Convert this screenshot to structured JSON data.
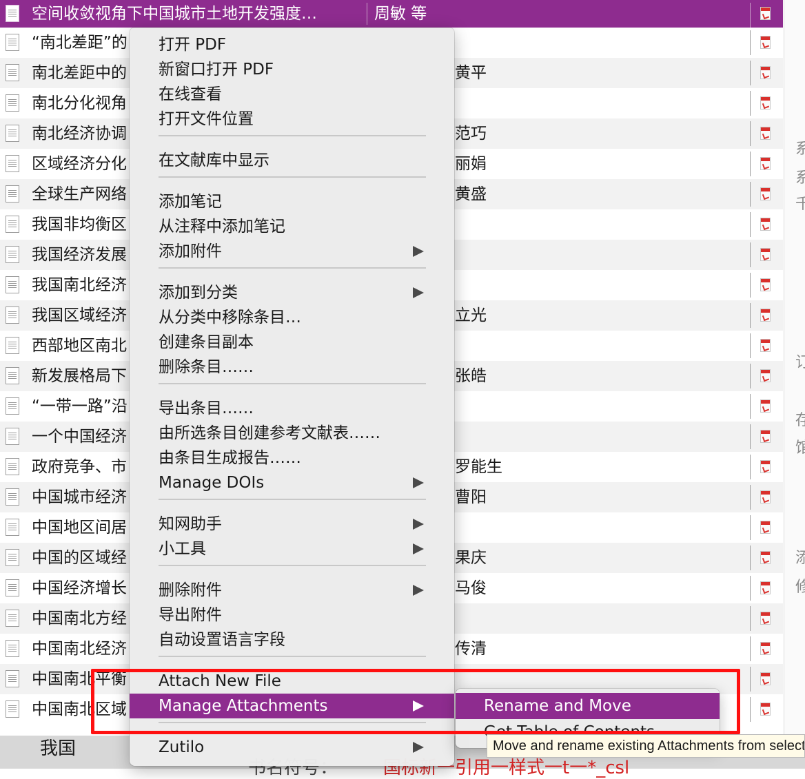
{
  "items": [
    {
      "title": "空间收敛视角下中国城市土地开发强度…",
      "creator": "周敏 等",
      "selected": true
    },
    {
      "title": "“南北差距”的",
      "creator": ""
    },
    {
      "title": "南北差距中的",
      "creator": "黄平"
    },
    {
      "title": "南北分化视角",
      "creator": ""
    },
    {
      "title": "南北经济协调",
      "creator": "范巧"
    },
    {
      "title": "区域经济分化",
      "creator": "丽娟"
    },
    {
      "title": "全球生产网络",
      "creator": "黄盛"
    },
    {
      "title": "我国非均衡区",
      "creator": ""
    },
    {
      "title": "我国经济发展",
      "creator": ""
    },
    {
      "title": "我国南北经济",
      "creator": ""
    },
    {
      "title": "我国区域经济",
      "creator": "立光"
    },
    {
      "title": "西部地区南北",
      "creator": ""
    },
    {
      "title": "新发展格局下",
      "creator": "张皓"
    },
    {
      "title": "“一带一路”沿",
      "creator": ""
    },
    {
      "title": "一个中国经济",
      "creator": ""
    },
    {
      "title": "政府竞争、市",
      "creator": "罗能生"
    },
    {
      "title": "中国城市经济",
      "creator": "曹阳"
    },
    {
      "title": "中国地区间居",
      "creator": ""
    },
    {
      "title": "中国的区域经",
      "creator": "果庆"
    },
    {
      "title": "中国经济增长",
      "creator": "马俊"
    },
    {
      "title": "中国南北方经",
      "creator": ""
    },
    {
      "title": "中国南北经济",
      "creator": "传清"
    },
    {
      "title": "中国南北平衡",
      "creator": ""
    },
    {
      "title": "中国南北区域",
      "creator": ""
    }
  ],
  "context_menu": {
    "groups": [
      [
        {
          "label": "打开 PDF"
        },
        {
          "label": "新窗口打开 PDF"
        },
        {
          "label": "在线查看"
        },
        {
          "label": "打开文件位置"
        }
      ],
      [
        {
          "label": "在文献库中显示"
        }
      ],
      [
        {
          "label": "添加笔记"
        },
        {
          "label": "从注释中添加笔记"
        },
        {
          "label": "添加附件",
          "submenu": true
        }
      ],
      [
        {
          "label": "添加到分类",
          "submenu": true
        },
        {
          "label": "从分类中移除条目…"
        },
        {
          "label": "创建条目副本"
        },
        {
          "label": "删除条目……"
        }
      ],
      [
        {
          "label": "导出条目……"
        },
        {
          "label": "由所选条目创建参考文献表……"
        },
        {
          "label": "由条目生成报告……"
        },
        {
          "label": "Manage DOIs",
          "submenu": true
        }
      ],
      [
        {
          "label": "知网助手",
          "submenu": true
        },
        {
          "label": "小工具",
          "submenu": true
        }
      ],
      [
        {
          "label": "删除附件",
          "submenu": true
        },
        {
          "label": "导出附件"
        },
        {
          "label": "自动设置语言字段"
        }
      ],
      [
        {
          "label": "Attach New File"
        },
        {
          "label": "Manage Attachments",
          "submenu": true,
          "highlighted": true
        }
      ],
      [
        {
          "label": "Zutilo",
          "submenu": true
        }
      ]
    ]
  },
  "submenu": {
    "items": [
      {
        "label": "Rename and Move",
        "highlighted": true
      },
      {
        "label": "Get Table of Contents"
      }
    ]
  },
  "tooltip": {
    "text": "Move and rename existing Attachments from selected items"
  },
  "right_pane": {
    "chars": [
      "系",
      "系",
      "千",
      "订",
      "存",
      "馆",
      "添",
      "修"
    ]
  },
  "bottom": {
    "left_text": "我国",
    "mid_text": "书名符号：",
    "right_text": "国标新一引用一样式一t一*_csl"
  },
  "colors": {
    "accent": "#8e2c8f",
    "annotation": "#ff1010"
  }
}
